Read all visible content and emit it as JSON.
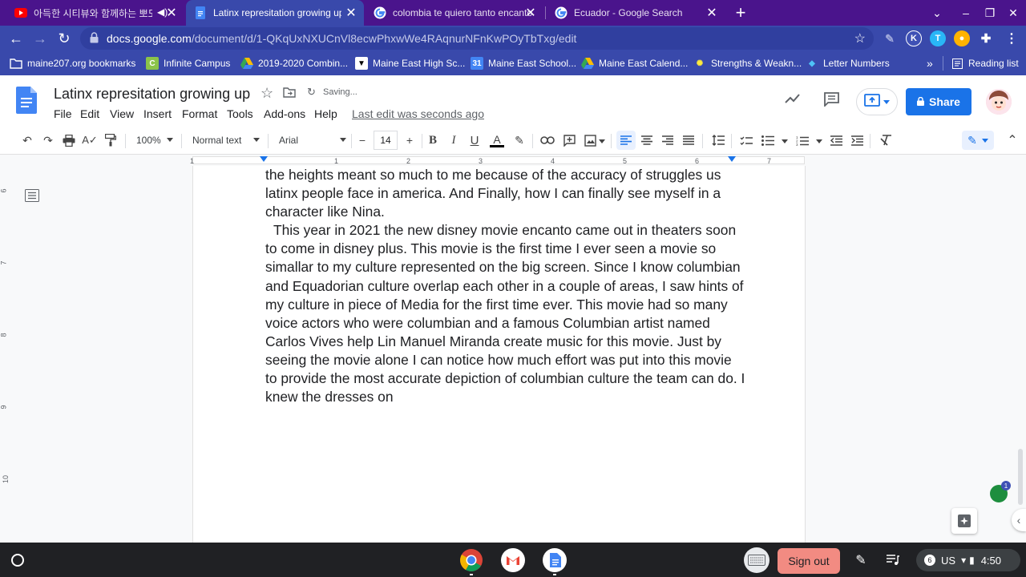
{
  "browser": {
    "tabs": [
      {
        "title": "아득한 시티뷰와 함께하는 뽀도",
        "icon": "youtube-icon"
      },
      {
        "title": "Latinx represitation growing up",
        "icon": "docs-icon"
      },
      {
        "title": "colombia te quiero tanto encanto",
        "icon": "google-icon"
      },
      {
        "title": "Ecuador - Google Search",
        "icon": "google-icon"
      }
    ],
    "url_domain": "docs.google.com",
    "url_path": "/document/d/1-QKqUxNXUCnVl8ecwPhxwWe4RAqnurNFnKwPOyTbTxg/edit",
    "bookmarks": [
      "maine207.org bookmarks",
      "Infinite Campus",
      "2019-2020 Combin...",
      "Maine East High Sc...",
      "Maine East School...",
      "Maine East Calend...",
      "Strengths & Weakn...",
      "Letter Numbers"
    ],
    "reading_list": "Reading list",
    "extension_letters": [
      "K",
      "T"
    ]
  },
  "doc": {
    "title": "Latinx represitation growing up",
    "saving": "Saving...",
    "last_edit": "Last edit was seconds ago",
    "menus": [
      "File",
      "Edit",
      "View",
      "Insert",
      "Format",
      "Tools",
      "Add-ons",
      "Help"
    ],
    "share_label": "Share",
    "toolbar": {
      "zoom": "100%",
      "style": "Normal text",
      "font": "Arial",
      "font_size": "14",
      "minus": "−",
      "plus": "+"
    },
    "ruler_numbers": [
      "1",
      "1",
      "2",
      "3",
      "4",
      "5",
      "6",
      "7"
    ],
    "vruler_numbers": [
      "6",
      "7",
      "8",
      "9",
      "10"
    ],
    "paragraph1": "the heights meant so much to me because of the accuracy of struggles us latinx people face in america. And Finally, how I can finally see myself in a character like Nina.",
    "paragraph2": "This year in 2021 the new disney movie encanto came out in theaters soon to come in disney plus. This movie is the first time I ever seen a movie so simallar to my culture represented on the big screen. Since I know columbian and Equadorian culture overlap each other in a couple of areas, I saw hints of my culture in piece of Media for the first time ever. This movie had so many voice actors who were columbian and a famous Columbian artist named Carlos Vives help Lin Manuel Miranda create music for this movie. Just by seeing the movie alone I can notice how much effort was put into this movie to provide the most accurate depiction of columbian culture the team can do. I knew the dresses on",
    "notification_count": "1"
  },
  "shelf": {
    "signout_label": "Sign out",
    "notif_count": "6",
    "locale": "US",
    "time": "4:50"
  },
  "colors": {
    "tabstrip": "#4a148c",
    "toolbar": "#3949ab",
    "share": "#1a73e8",
    "signout": "#f28b82"
  }
}
